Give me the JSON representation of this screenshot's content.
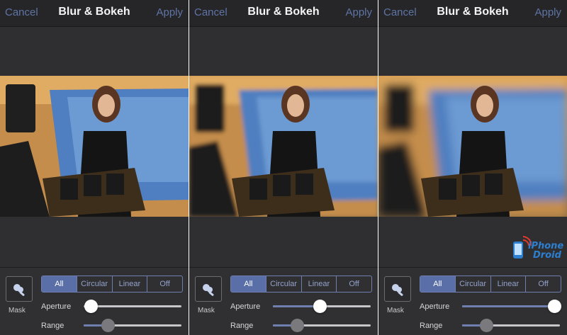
{
  "colors": {
    "accent": "#5f74a6",
    "segment_active": "#5a6fa8",
    "panel_bg": "#2f2f31",
    "topbar_bg": "#262628"
  },
  "panels": [
    {
      "header": {
        "cancel": "Cancel",
        "title": "Blur & Bokeh",
        "apply": "Apply"
      },
      "blur_level": "none",
      "mask": {
        "icon": "mask-brush-icon",
        "label": "Mask"
      },
      "modes": {
        "options": [
          "All",
          "Circular",
          "Linear",
          "Off"
        ],
        "selected": "All"
      },
      "aperture": {
        "label": "Aperture",
        "value": 0.0
      },
      "range": {
        "label": "Range",
        "value": 0.25
      }
    },
    {
      "header": {
        "cancel": "Cancel",
        "title": "Blur & Bokeh",
        "apply": "Apply"
      },
      "blur_level": "medium",
      "mask": {
        "icon": "mask-brush-icon",
        "label": "Mask"
      },
      "modes": {
        "options": [
          "All",
          "Circular",
          "Linear",
          "Off"
        ],
        "selected": "All"
      },
      "aperture": {
        "label": "Aperture",
        "value": 0.47
      },
      "range": {
        "label": "Range",
        "value": 0.25
      }
    },
    {
      "header": {
        "cancel": "Cancel",
        "title": "Blur & Bokeh",
        "apply": "Apply"
      },
      "blur_level": "strong",
      "mask": {
        "icon": "mask-brush-icon",
        "label": "Mask"
      },
      "modes": {
        "options": [
          "All",
          "Circular",
          "Linear",
          "Off"
        ],
        "selected": "All"
      },
      "aperture": {
        "label": "Aperture",
        "value": 1.0
      },
      "range": {
        "label": "Range",
        "value": 0.25
      }
    }
  ],
  "watermark": {
    "line1": "iPhone",
    "line2": "Droid"
  }
}
